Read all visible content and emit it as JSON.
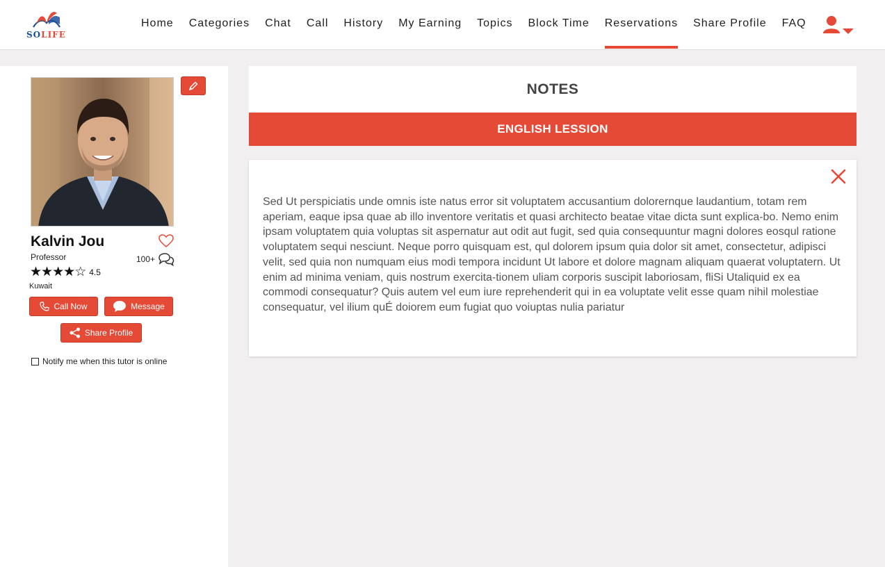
{
  "brand": {
    "name_primary": "SO",
    "name_accent": "LIFE",
    "colors": {
      "accent": "#e44a36",
      "brand_blue": "#1d4f9c"
    }
  },
  "nav": {
    "items": [
      {
        "label": "Home",
        "active": false
      },
      {
        "label": "Categories",
        "active": false
      },
      {
        "label": "Chat",
        "active": false
      },
      {
        "label": "Call",
        "active": false
      },
      {
        "label": "History",
        "active": false
      },
      {
        "label": "My Earning",
        "active": false
      },
      {
        "label": "Topics",
        "active": false
      },
      {
        "label": "Block Time",
        "active": false
      },
      {
        "label": "Reservations",
        "active": true
      },
      {
        "label": "Share Profile",
        "active": false
      },
      {
        "label": "FAQ",
        "active": false
      }
    ],
    "user_icon": "user-icon",
    "dropdown_icon": "caret-down-icon"
  },
  "profile": {
    "name": "Kalvin Jou",
    "title": "Professor",
    "rating_value": 4.5,
    "rating_text": "4.5",
    "review_count": "100+",
    "country": "Kuwait",
    "call_label": "Call Now",
    "message_label": "Message",
    "share_label": "Share Profile",
    "notify_label": "Notify me when this tutor is online",
    "notify_checked": false
  },
  "notes": {
    "heading": "NOTES",
    "lesson_title": "ENGLISH LESSION",
    "body": "Sed Ut perspiciatis unde omnis iste natus error sit voluptatem accusantium dolorernque laudantium, totam rem aperiam, eaque ipsa quae ab illo inventore veritatis et quasi architecto beatae vitae dicta sunt explica-bo. Nemo enim ipsam voluptatem quia voluptas sit aspernatur aut odit aut fugit, sed quia consequuntur magni dolores eosqul ratione voluptatem sequi nesciunt. Neque porro quisquam est, qul dolorem ipsum quia dolor sit amet, consectetur, adipisci velit, sed quia non numquam eius modi tempora incidunt Ut labore et dolore magnam aliquam quaerat voluptatern. Ut enim ad minima veniam, quis nostrum exercita-tionem uliam corporis suscipit laboriosam, fliSi Utaliquid ex ea commodi consequatur? Quis autem vel eum iure reprehenderit qui in ea voluptate velit esse quam nihil molestiae consequatur, vel ilium quÉ doiorem eum fugiat quo voiuptas nulia pariatur"
  }
}
